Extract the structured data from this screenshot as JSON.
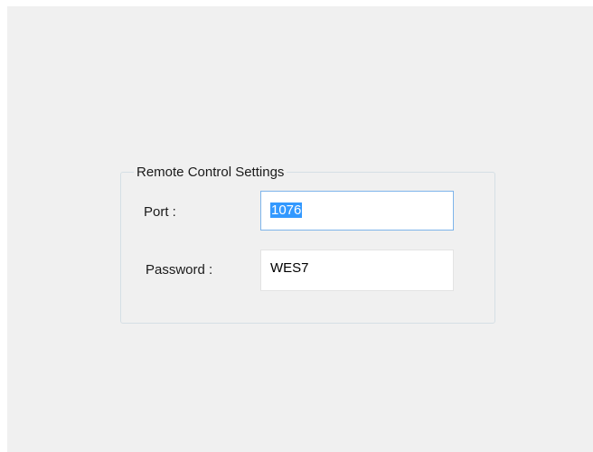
{
  "group": {
    "title": "Remote Control Settings"
  },
  "fields": {
    "port": {
      "label": "Port :",
      "value": "1076",
      "selected": true
    },
    "password": {
      "label": "Password :",
      "value": "WES7"
    }
  },
  "colors": {
    "panel_background": "#f0f0f0",
    "focus_border": "#7eb4ea",
    "selection": "#3399ff",
    "groupbox_border": "#d5dfe5"
  }
}
